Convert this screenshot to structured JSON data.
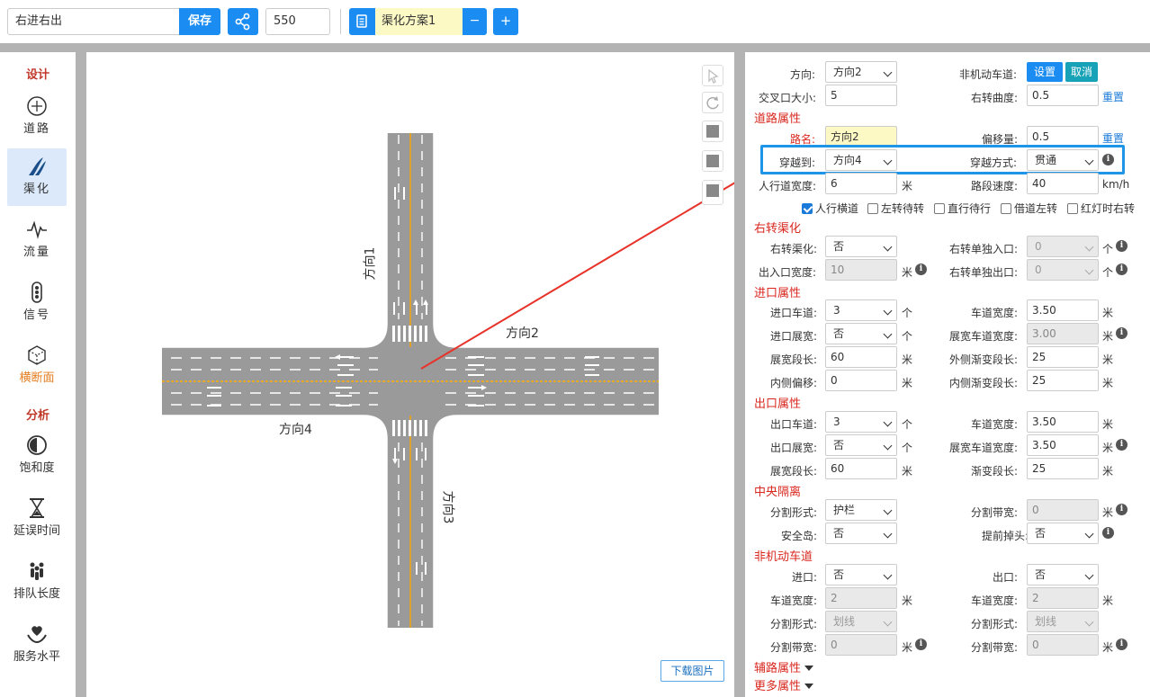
{
  "topbar": {
    "project_name": "右进右出",
    "save_label": "保存",
    "size_value": "550",
    "plan_name": "渠化方案1",
    "minus_label": "−",
    "plus_label": "+"
  },
  "sidebar": {
    "design_title": "设计",
    "analysis_title": "分析",
    "items": [
      {
        "label": "道路",
        "icon": "crosshair-icon"
      },
      {
        "label": "渠化",
        "icon": "channelization-icon"
      },
      {
        "label": "流量",
        "icon": "pulse-icon"
      },
      {
        "label": "信号",
        "icon": "traffic-light-icon"
      },
      {
        "label": "横断面",
        "icon": "cube-icon"
      },
      {
        "label": "饱和度",
        "icon": "half-circle-icon"
      },
      {
        "label": "延误时间",
        "icon": "hourglass-icon"
      },
      {
        "label": "排队长度",
        "icon": "people-icon"
      },
      {
        "label": "服务水平",
        "icon": "heart-hand-icon"
      }
    ],
    "active_item": "渠化"
  },
  "canvas": {
    "road_labels": [
      "方向1",
      "方向2",
      "方向3",
      "方向4"
    ],
    "download_label": "下载图片"
  },
  "panel": {
    "direction_label": "方向:",
    "direction_value": "方向2",
    "nonmotor_label": "非机动车道:",
    "set_label": "设置",
    "cancel_label": "取消",
    "size_label": "交叉口大小:",
    "size_value": "5",
    "curve_label": "右转曲度:",
    "curve_value": "0.5",
    "reset_label": "重置",
    "road_section": "道路属性",
    "road_name_label": "路名:",
    "road_name_value": "方向2",
    "offset_label": "偏移量:",
    "offset_value": "0.5",
    "reset2_label": "重置",
    "cross_to_label": "穿越到:",
    "cross_to_value": "方向4",
    "cross_mode_label": "穿越方式:",
    "cross_mode_value": "贯通",
    "sidewalk_width_label": "人行道宽度:",
    "sidewalk_width_value": "6",
    "unit_m": "米",
    "speed_label": "路段速度:",
    "speed_value": "40",
    "speed_unit": "km/h",
    "checkboxes": [
      {
        "label": "人行横道",
        "checked": true
      },
      {
        "label": "左转待转",
        "checked": false
      },
      {
        "label": "直行待行",
        "checked": false
      },
      {
        "label": "借道左转",
        "checked": false
      },
      {
        "label": "红灯时右转",
        "checked": false
      }
    ],
    "right_turn_section": "右转渠化",
    "rt_channel_label": "右转渠化:",
    "rt_channel_value": "否",
    "rt_entry_label": "右转单独入口:",
    "rt_entry_value": "0",
    "unit_count": "个",
    "rt_width_label": "出入口宽度:",
    "rt_width_value": "10",
    "rt_exit_label": "右转单独出口:",
    "rt_exit_value": "0",
    "entry_section": "进口属性",
    "en_lanes_label": "进口车道:",
    "en_lanes_value": "3",
    "en_lane_width_label": "车道宽度:",
    "en_lane_width_value": "3.50",
    "en_expand_label": "进口展宽:",
    "en_expand_value": "否",
    "en_expand_width_label": "展宽车道宽度:",
    "en_expand_width_value": "3.00",
    "en_expand_len_label": "展宽段长:",
    "en_expand_len_value": "60",
    "en_outer_label": "外侧渐变段长:",
    "en_outer_value": "25",
    "en_inner_offset_label": "内侧偏移:",
    "en_inner_offset_value": "0",
    "en_inner_label": "内侧渐变段长:",
    "en_inner_value": "25",
    "exit_section": "出口属性",
    "ex_lanes_label": "出口车道:",
    "ex_lanes_value": "3",
    "ex_lane_width_label": "车道宽度:",
    "ex_lane_width_value": "3.50",
    "ex_expand_label": "出口展宽:",
    "ex_expand_value": "否",
    "ex_expand_width_label": "展宽车道宽度:",
    "ex_expand_width_value": "3.50",
    "ex_expand_len_label": "展宽段长:",
    "ex_expand_len_value": "60",
    "ex_taper_label": "渐变段长:",
    "ex_taper_value": "25",
    "median_section": "中央隔离",
    "med_form_label": "分割形式:",
    "med_form_value": "护栏",
    "med_width_label": "分割带宽:",
    "med_width_value": "0",
    "island_label": "安全岛:",
    "island_value": "否",
    "uturn_label": "提前掉头:",
    "uturn_value": "否",
    "nonmotor_section": "非机动车道",
    "nm_in_label": "进口:",
    "nm_in_value": "否",
    "nm_out_label": "出口:",
    "nm_out_value": "否",
    "nm_w1_label": "车道宽度:",
    "nm_w1_value": "2",
    "nm_w2_label": "车道宽度:",
    "nm_w2_value": "2",
    "nm_f1_label": "分割形式:",
    "nm_f1_value": "划线",
    "nm_f2_label": "分割形式:",
    "nm_f2_value": "划线",
    "nm_b1_label": "分割带宽:",
    "nm_b1_value": "0",
    "nm_b2_label": "分割带宽:",
    "nm_b2_value": "0",
    "aux_section": "辅路属性",
    "more_section": "更多属性"
  },
  "colors": {
    "accent": "#1a8cf2",
    "section_red": "#d9281f",
    "highlight_blue": "#1f95e8",
    "arrow_red": "#e8332a",
    "road_gray": "#999999"
  }
}
